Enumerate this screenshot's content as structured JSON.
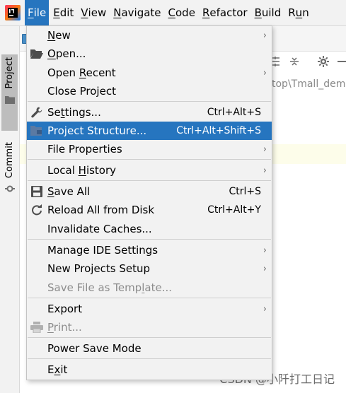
{
  "menubar": {
    "items": [
      {
        "pre": "",
        "mn": "F",
        "post": "ile"
      },
      {
        "pre": "",
        "mn": "E",
        "post": "dit"
      },
      {
        "pre": "",
        "mn": "V",
        "post": "iew"
      },
      {
        "pre": "",
        "mn": "N",
        "post": "avigate"
      },
      {
        "pre": "",
        "mn": "C",
        "post": "ode"
      },
      {
        "pre": "",
        "mn": "R",
        "post": "efactor"
      },
      {
        "pre": "",
        "mn": "B",
        "post": "uild"
      },
      {
        "pre": "R",
        "mn": "u",
        "post": "n"
      }
    ]
  },
  "left_stripe": {
    "project_label": "Project",
    "commit_label": "Commit"
  },
  "background": {
    "path_fragment": "top\\Tmall_dem"
  },
  "file_menu": {
    "items": [
      {
        "pre": "",
        "mn": "N",
        "post": "ew",
        "shortcut": "",
        "arrow": "›"
      },
      {
        "pre": "",
        "mn": "O",
        "post": "pen...",
        "shortcut": "",
        "arrow": ""
      },
      {
        "pre": "Open ",
        "mn": "R",
        "post": "ecent",
        "shortcut": "",
        "arrow": "›"
      },
      {
        "pre": "Close Project",
        "mn": "",
        "post": "",
        "shortcut": "",
        "arrow": ""
      },
      {
        "pre": "Se",
        "mn": "t",
        "post": "tings...",
        "shortcut": "Ctrl+Alt+S",
        "arrow": ""
      },
      {
        "pre": "Project Structure...",
        "mn": "",
        "post": "",
        "shortcut": "Ctrl+Alt+Shift+S",
        "arrow": ""
      },
      {
        "pre": "File Properties",
        "mn": "",
        "post": "",
        "shortcut": "",
        "arrow": "›"
      },
      {
        "pre": "Local ",
        "mn": "H",
        "post": "istory",
        "shortcut": "",
        "arrow": "›"
      },
      {
        "pre": "",
        "mn": "S",
        "post": "ave All",
        "shortcut": "Ctrl+S",
        "arrow": ""
      },
      {
        "pre": "Reload All from Disk",
        "mn": "",
        "post": "",
        "shortcut": "Ctrl+Alt+Y",
        "arrow": ""
      },
      {
        "pre": "Invalidate Caches...",
        "mn": "",
        "post": "",
        "shortcut": "",
        "arrow": ""
      },
      {
        "pre": "Manage IDE Settings",
        "mn": "",
        "post": "",
        "shortcut": "",
        "arrow": "›"
      },
      {
        "pre": "New Projects Setup",
        "mn": "",
        "post": "",
        "shortcut": "",
        "arrow": "›"
      },
      {
        "pre": "Save File as Temp",
        "mn": "l",
        "post": "ate...",
        "shortcut": "",
        "arrow": ""
      },
      {
        "pre": "Export",
        "mn": "",
        "post": "",
        "shortcut": "",
        "arrow": "›"
      },
      {
        "pre": "",
        "mn": "P",
        "post": "rint...",
        "shortcut": "",
        "arrow": ""
      },
      {
        "pre": "Power Save Mode",
        "mn": "",
        "post": "",
        "shortcut": "",
        "arrow": ""
      },
      {
        "pre": "E",
        "mn": "x",
        "post": "it",
        "shortcut": "",
        "arrow": ""
      }
    ]
  },
  "watermark": "CSDN @小阡打工日记",
  "colors": {
    "menu_active": "#2675bf",
    "menu_bg": "#f2f2f2",
    "disabled_text": "#8c8c8c"
  }
}
